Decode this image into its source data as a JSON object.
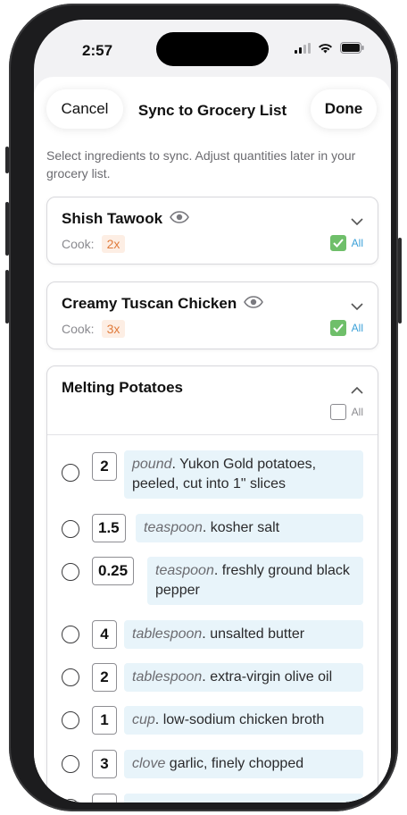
{
  "status": {
    "time": "2:57"
  },
  "nav": {
    "cancel_label": "Cancel",
    "title": "Sync to Grocery List",
    "done_label": "Done"
  },
  "hint": "Select ingredients to sync. Adjust quantities later in your grocery list.",
  "recipes": [
    {
      "name": "Shish Tawook",
      "cook_label": "Cook:",
      "multiplier": "2x",
      "all_label": "All",
      "all_checked": true
    },
    {
      "name": "Creamy Tuscan Chicken",
      "cook_label": "Cook:",
      "multiplier": "3x",
      "all_label": "All",
      "all_checked": true
    },
    {
      "name": "Melting Potatoes",
      "all_label": "All",
      "all_checked": false,
      "ingredients": [
        {
          "qty": "2",
          "unit": "pound",
          "text": ". Yukon Gold potatoes, peeled, cut into 1\" slices"
        },
        {
          "qty": "1.5",
          "unit": "teaspoon",
          "text": ". kosher salt"
        },
        {
          "qty": "0.25",
          "unit": "teaspoon",
          "text": ". freshly ground black pepper"
        },
        {
          "qty": "4",
          "unit": "tablespoon",
          "text": ". unsalted butter"
        },
        {
          "qty": "2",
          "unit": "tablespoon",
          "text": ". extra-virgin olive oil"
        },
        {
          "qty": "1",
          "unit": "cup",
          "text": ". low-sodium chicken broth"
        },
        {
          "qty": "3",
          "unit": "clove",
          "text": " garlic, finely chopped"
        }
      ]
    }
  ],
  "colors": {
    "accent_blue": "#3aa0d8",
    "check_green": "#6fbf6a",
    "multiplier_orange": "#e07b3c",
    "ingredient_bg": "#e8f4fa"
  }
}
